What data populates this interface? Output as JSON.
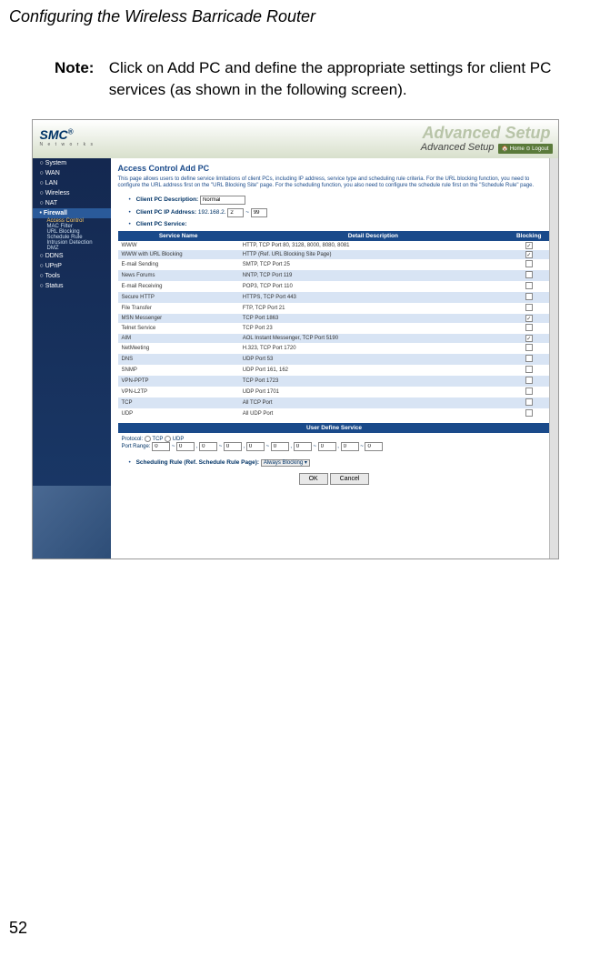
{
  "header": "Configuring the Wireless Barricade Router",
  "note": {
    "label": "Note:",
    "text": "Click on Add PC and define the appropriate settings for client PC services (as shown in the following screen)."
  },
  "screenshot": {
    "logo": "SMC",
    "logo_sub": "N e t w o r k s",
    "adv_bg": "Advanced Setup",
    "adv_fg": "Advanced Setup",
    "home_logout": "🏠 Home   ⊙ Logout",
    "sidebar": {
      "items": [
        "System",
        "WAN",
        "LAN",
        "Wireless",
        "NAT",
        "Firewall",
        "DDNS",
        "UPnP",
        "Tools",
        "Status"
      ],
      "firewall_sub": [
        "Access Control",
        "MAC Filter",
        "URL Blocking",
        "Schedule Rule",
        "Intrusion Detection",
        "DMZ"
      ]
    },
    "main": {
      "title": "Access Control Add PC",
      "desc": "This page allows users to define service limitations of client PCs, including IP address, service type and scheduling rule criteria. For the URL blocking function, you need to configure the URL address first on the \"URL Blocking Site\" page. For the scheduling function, you also need to configure the schedule rule first on the \"Schedule Rule\" page.",
      "desc_label": "Client PC Description:",
      "desc_value": "Normal",
      "ip_label": "Client PC IP Address:",
      "ip_prefix": "192.168.2.",
      "ip_from": "2",
      "ip_to": "99",
      "svc_label": "Client PC Service:",
      "cols": [
        "Service Name",
        "Detail Description",
        "Blocking"
      ],
      "rows": [
        {
          "name": "WWW",
          "detail": "HTTP, TCP Port 80, 3128, 8000, 8080, 8081",
          "chk": true
        },
        {
          "name": "WWW with URL Blocking",
          "detail": "HTTP (Ref. URL Blocking Site Page)",
          "chk": true
        },
        {
          "name": "E-mail Sending",
          "detail": "SMTP, TCP Port 25",
          "chk": false
        },
        {
          "name": "News Forums",
          "detail": "NNTP, TCP Port 119",
          "chk": false
        },
        {
          "name": "E-mail Receiving",
          "detail": "POP3, TCP Port 110",
          "chk": false
        },
        {
          "name": "Secure HTTP",
          "detail": "HTTPS, TCP Port 443",
          "chk": false
        },
        {
          "name": "File Transfer",
          "detail": "FTP, TCP Port 21",
          "chk": false
        },
        {
          "name": "MSN Messenger",
          "detail": "TCP Port 1863",
          "chk": true
        },
        {
          "name": "Telnet Service",
          "detail": "TCP Port 23",
          "chk": false
        },
        {
          "name": "AIM",
          "detail": "AOL Instant Messenger, TCP Port 5190",
          "chk": true
        },
        {
          "name": "NetMeeting",
          "detail": "H.323, TCP Port 1720",
          "chk": false
        },
        {
          "name": "DNS",
          "detail": "UDP Port 53",
          "chk": false
        },
        {
          "name": "SNMP",
          "detail": "UDP Port 161, 162",
          "chk": false
        },
        {
          "name": "VPN-PPTP",
          "detail": "TCP Port 1723",
          "chk": false
        },
        {
          "name": "VPN-L2TP",
          "detail": "UDP Port 1701",
          "chk": false
        },
        {
          "name": "TCP",
          "detail": "All TCP Port",
          "chk": false
        },
        {
          "name": "UDP",
          "detail": "All UDP Port",
          "chk": false
        }
      ],
      "uds_header": "User Define Service",
      "uds_protocol_label": "Protocol:",
      "uds_tcp": "TCP",
      "uds_udp": "UDP",
      "uds_range_label": "Port Range:",
      "uds_zero": "0",
      "sched_label": "Scheduling Rule (Ref. Schedule Rule Page):",
      "sched_value": "Always Blocking",
      "ok": "OK",
      "cancel": "Cancel"
    }
  },
  "page_number": "52"
}
